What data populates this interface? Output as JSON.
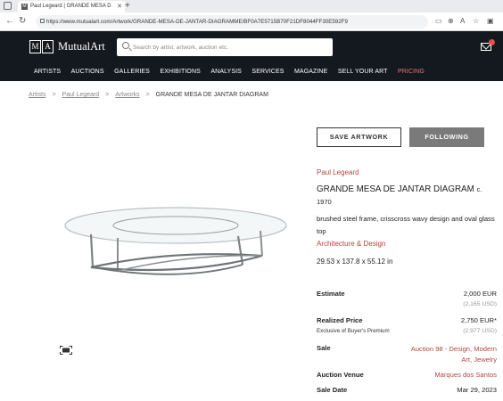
{
  "browser": {
    "tab_title": "Paul Legeard | GRANDE MESA D",
    "tab_favicon": "M",
    "new_tab": "+",
    "url": "https://www.mutualart.com/Artwork/GRANDE-MESA-DE-JANTAR-DIAGRAMME/BF0A7E5715B70F21DF8044FF30E592F9"
  },
  "header": {
    "logo_m": "M",
    "logo_a": "A",
    "logo_name": "MutualArt",
    "search_placeholder": "Search by artist, artwork, auction etc."
  },
  "nav": {
    "items": [
      "ARTISTS",
      "AUCTIONS",
      "GALLERIES",
      "EXHIBITIONS",
      "ANALYSIS",
      "SERVICES",
      "MAGAZINE",
      "SELL YOUR ART",
      "PRICING"
    ],
    "accent_color": "#e07a6e"
  },
  "breadcrumb": {
    "items": [
      "Artists",
      "Paul Legeard",
      "Artworks"
    ],
    "separator": ">",
    "current": "GRANDE MESA DE JANTAR DIAGRAM"
  },
  "actions": {
    "save_label": "SAVE ARTWORK",
    "follow_label": "FOLLOWING"
  },
  "artwork": {
    "artist": "Paul Legeard",
    "title": "GRANDE MESA DE JANTAR DIAGRAM",
    "year": "c. 1970",
    "description": "brushed steel frame, crisscross wavy design and oval glass top",
    "category": "Architecture & Design",
    "dimensions": "29.53 x 137.8 x 55.12 in"
  },
  "details": {
    "estimate_label": "Estimate",
    "estimate_value": "2,000 EUR",
    "estimate_usd": "(2,165 USD)",
    "realized_label": "Realized Price",
    "realized_value": "2,750 EUR*",
    "realized_note": "Exclusive of Buyer's Premium",
    "realized_usd": "(2,977 USD)",
    "sale_label": "Sale",
    "sale_value_1": "Auction 98 - Design, Modern",
    "sale_value_2": "Art, Jewelry",
    "venue_label": "Auction Venue",
    "venue_value": "Marques dos Santos",
    "date_label": "Sale Date",
    "date_value": "Mar 29, 2023"
  },
  "colors": {
    "header_bg": "#14191f",
    "link": "#b5473d"
  }
}
